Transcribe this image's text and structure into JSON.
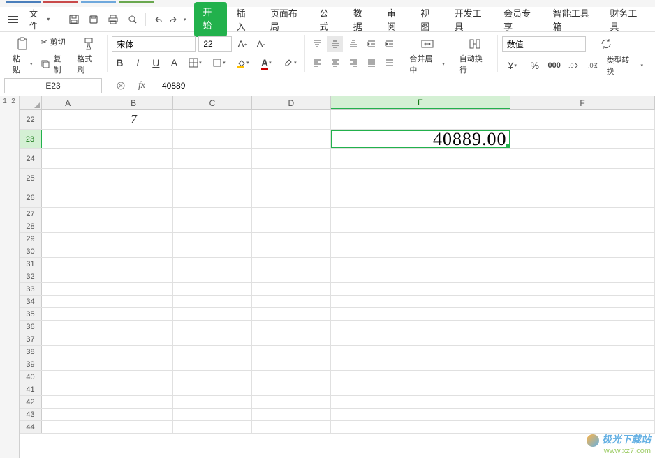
{
  "menu": {
    "file_label": "文件"
  },
  "ribbon_tabs": [
    "开始",
    "插入",
    "页面布局",
    "公式",
    "数据",
    "审阅",
    "视图",
    "开发工具",
    "会员专享",
    "智能工具箱",
    "财务工具"
  ],
  "active_ribbon_tab": "开始",
  "clipboard": {
    "paste_label": "粘贴",
    "cut_label": "剪切",
    "copy_label": "复制",
    "format_painter_label": "格式刷"
  },
  "font": {
    "name": "宋体",
    "size": "22"
  },
  "alignment": {
    "merge_center_label": "合并居中",
    "wrap_text_label": "自动换行"
  },
  "number_format": {
    "format_label": "数值",
    "type_convert_label": "类型转换"
  },
  "formula_bar": {
    "cell_ref": "E23",
    "formula_value": "40889"
  },
  "outline_levels": [
    "1",
    "2"
  ],
  "columns": [
    "A",
    "B",
    "C",
    "D",
    "E",
    "F"
  ],
  "rows": [
    {
      "num": "22",
      "tall": true,
      "cells": {
        "B": "7"
      }
    },
    {
      "num": "23",
      "tall": true,
      "active": true,
      "cells": {
        "E": "40889.00"
      }
    },
    {
      "num": "24",
      "tall": true
    },
    {
      "num": "25",
      "tall": true
    },
    {
      "num": "26",
      "tall": true
    },
    {
      "num": "27"
    },
    {
      "num": "28"
    },
    {
      "num": "29"
    },
    {
      "num": "30"
    },
    {
      "num": "31"
    },
    {
      "num": "32"
    },
    {
      "num": "33"
    },
    {
      "num": "34"
    },
    {
      "num": "35"
    },
    {
      "num": "36"
    },
    {
      "num": "37"
    },
    {
      "num": "38"
    },
    {
      "num": "39"
    },
    {
      "num": "40"
    },
    {
      "num": "41"
    },
    {
      "num": "42"
    },
    {
      "num": "43"
    },
    {
      "num": "44"
    }
  ],
  "active_cell": {
    "row": "23",
    "col": "E"
  },
  "watermark": {
    "title": "极光下载站",
    "url": "www.xz7.com"
  }
}
